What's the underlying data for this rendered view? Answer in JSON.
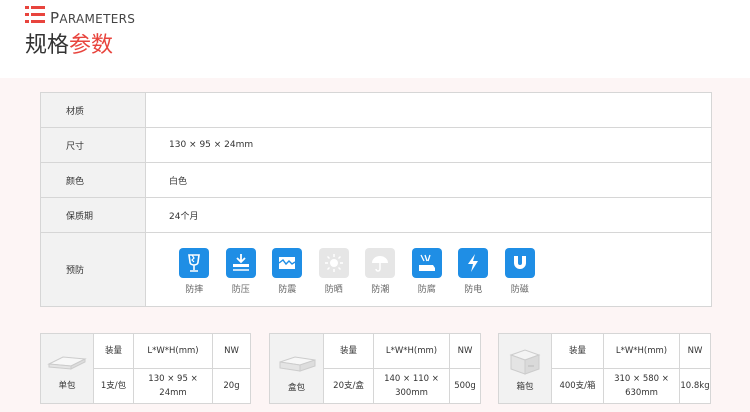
{
  "header": {
    "title_en_first": "P",
    "title_en_rest": "ARAMETERS",
    "title_cn_black": "规格",
    "title_cn_red": "参数"
  },
  "spec": {
    "rows": [
      {
        "label": "材质",
        "value": ""
      },
      {
        "label": "尺寸",
        "value": "130 × 95 × 24mm"
      },
      {
        "label": "颜色",
        "value": "白色"
      },
      {
        "label": "保质期",
        "value": "24个月"
      }
    ],
    "protection_label": "预防",
    "protections": [
      {
        "label": "防摔",
        "icon": "broken-glass-icon",
        "active": true
      },
      {
        "label": "防压",
        "icon": "press-down-icon",
        "active": true
      },
      {
        "label": "防震",
        "icon": "vibration-icon",
        "active": true
      },
      {
        "label": "防晒",
        "icon": "sun-icon",
        "active": false
      },
      {
        "label": "防潮",
        "icon": "umbrella-icon",
        "active": false
      },
      {
        "label": "防腐",
        "icon": "corrosion-icon",
        "active": true
      },
      {
        "label": "防电",
        "icon": "lightning-icon",
        "active": true
      },
      {
        "label": "防磁",
        "icon": "magnet-icon",
        "active": true
      }
    ]
  },
  "packaging": {
    "headers": {
      "qty": "装量",
      "dim": "L*W*H(mm)",
      "nw": "NW"
    },
    "items": [
      {
        "name": "单包",
        "qty": "1支/包",
        "dim": "130 × 95 × 24mm",
        "nw": "20g"
      },
      {
        "name": "盒包",
        "qty": "20支/盒",
        "dim": "140 × 110 × 300mm",
        "nw": "500g"
      },
      {
        "name": "箱包",
        "qty": "400支/箱",
        "dim": "310 × 580 × 630mm",
        "nw": "10.8kg"
      }
    ]
  },
  "colors": {
    "accent": "#e8443d",
    "icon_blue": "#1f8ee5",
    "icon_disabled": "#e6e6e6"
  }
}
